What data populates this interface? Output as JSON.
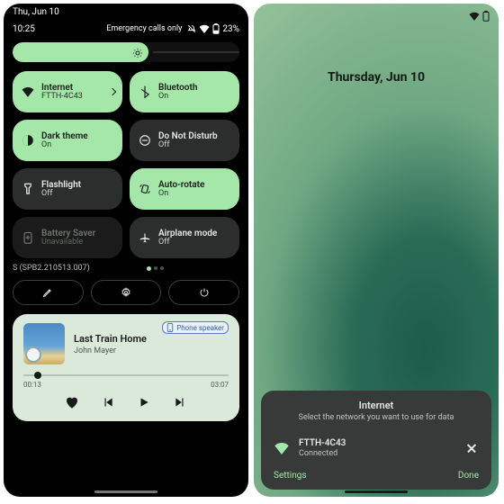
{
  "left": {
    "statusDate": "Thu, Jun 10",
    "clock": "10:25",
    "emergency": "Emergency calls only",
    "batteryPercent": "23%",
    "brightness": {
      "percent": 60
    },
    "tiles": [
      {
        "id": "internet",
        "label": "Internet",
        "sub": "FTTH-4C43",
        "state": "on",
        "icon": "wifi",
        "chevron": true
      },
      {
        "id": "bluetooth",
        "label": "Bluetooth",
        "sub": "On",
        "state": "on",
        "icon": "bluetooth"
      },
      {
        "id": "darktheme",
        "label": "Dark theme",
        "sub": "On",
        "state": "on",
        "icon": "darkmode"
      },
      {
        "id": "dnd",
        "label": "Do Not Disturb",
        "sub": "Off",
        "state": "off",
        "icon": "dnd"
      },
      {
        "id": "flashlight",
        "label": "Flashlight",
        "sub": "Off",
        "state": "off",
        "icon": "flashlight"
      },
      {
        "id": "autorotate",
        "label": "Auto-rotate",
        "sub": "On",
        "state": "on",
        "icon": "rotate"
      },
      {
        "id": "battsaver",
        "label": "Battery Saver",
        "sub": "Unavailable",
        "state": "dim",
        "icon": "battsaver"
      },
      {
        "id": "airplane",
        "label": "Airplane mode",
        "sub": "Off",
        "state": "off",
        "icon": "airplane"
      }
    ],
    "build": "S (SPB2.210513.007)",
    "pageDots": {
      "count": 3,
      "active": 0
    },
    "actions": {
      "edit": "edit",
      "settings": "settings",
      "power": "power"
    },
    "media": {
      "outputChip": "Phone speaker",
      "title": "Last Train Home",
      "artist": "John Mayer",
      "elapsed": "00:13",
      "duration": "03:07",
      "progressPct": 7
    }
  },
  "right": {
    "date": "Thursday, Jun 10",
    "sheet": {
      "title": "Internet",
      "subtitle": "Select the network you want to use for data",
      "network": {
        "name": "FTTH-4C43",
        "status": "Connected"
      },
      "settings": "Settings",
      "done": "Done"
    }
  },
  "colors": {
    "accent": "#a4e7a8",
    "tileOff": "#2b2e2c",
    "tileDim": "#1a1b1a"
  }
}
